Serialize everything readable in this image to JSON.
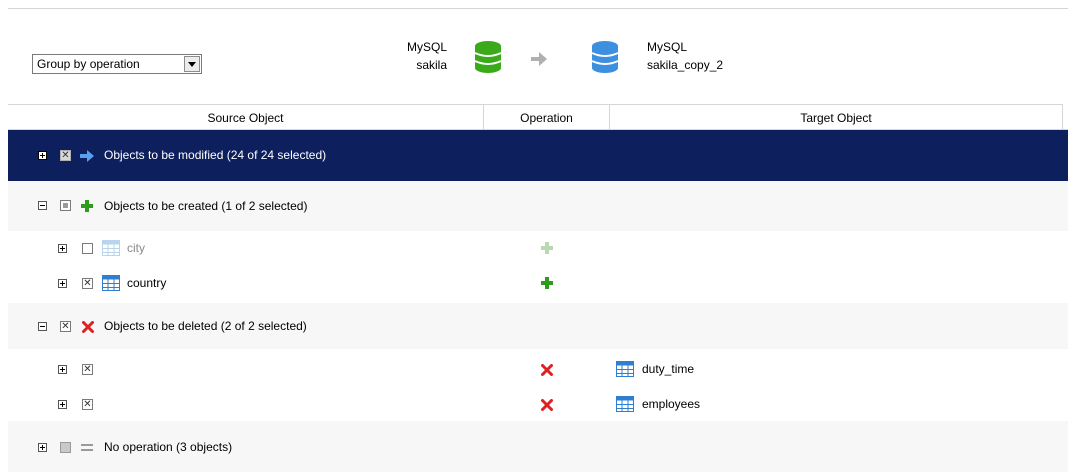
{
  "toolbar": {
    "group_by": "Group by operation"
  },
  "source": {
    "server": "MySQL",
    "schema": "sakila"
  },
  "target": {
    "server": "MySQL",
    "schema": "sakila_copy_2"
  },
  "columns": {
    "source": "Source Object",
    "operation": "Operation",
    "target": "Target Object"
  },
  "groups": {
    "modified": "Objects to be modified (24 of 24 selected)",
    "created": "Objects to be created (1 of 2 selected)",
    "deleted": "Objects to be deleted (2 of 2 selected)",
    "none": "No operation (3 objects)"
  },
  "created_items": [
    {
      "name": "city",
      "checked": false
    },
    {
      "name": "country",
      "checked": true
    }
  ],
  "deleted_items": [
    {
      "target": "duty_time",
      "checked": true
    },
    {
      "target": "employees",
      "checked": true
    }
  ],
  "colors": {
    "selected_row": "#0d1f5c",
    "add_green": "#2e9a1e",
    "delete_red": "#e02020",
    "table_blue": "#2f7fd0"
  }
}
